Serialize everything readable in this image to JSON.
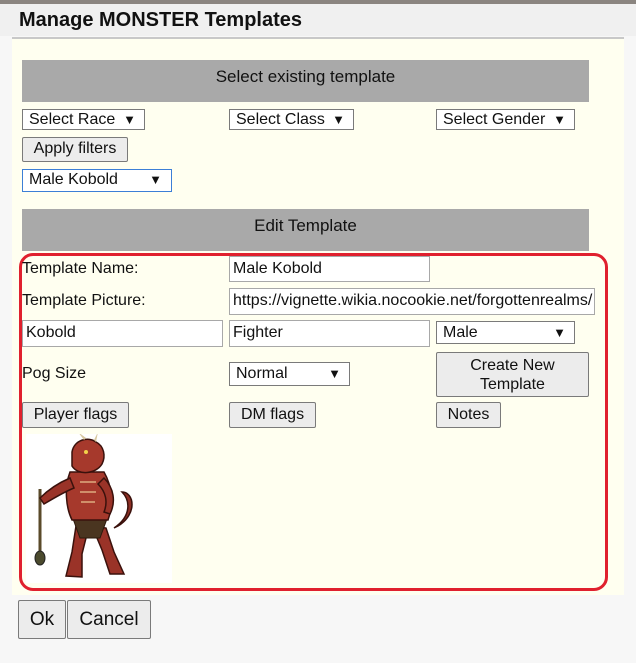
{
  "dialog": {
    "title": "Manage MONSTER Templates"
  },
  "select_section": {
    "header": "Select existing template",
    "race": "Select Race",
    "class": "Select Class",
    "gender": "Select Gender",
    "apply_filters": "Apply filters",
    "template_selected": "Male Kobold"
  },
  "edit_section": {
    "header": "Edit Template",
    "name_label": "Template Name:",
    "name_value": "Male Kobold",
    "picture_label": "Template Picture:",
    "picture_value": "https://vignette.wikia.nocookie.net/forgottenrealms/",
    "race_value": "Kobold",
    "class_value": "Fighter",
    "gender_value": "Male",
    "pog_label": "Pog Size",
    "pog_value": "Normal",
    "create_new_line1": "Create New",
    "create_new_line2": "Template",
    "player_flags": "Player flags",
    "dm_flags": "DM flags",
    "notes": "Notes"
  },
  "footer": {
    "ok": "Ok",
    "cancel": "Cancel"
  },
  "icons": {
    "dropdown": "▼"
  },
  "colors": {
    "highlight_border": "#e0202e",
    "header_bg": "#a9a9a9",
    "content_bg": "#fffff0",
    "focus": "#3c7fd6"
  }
}
